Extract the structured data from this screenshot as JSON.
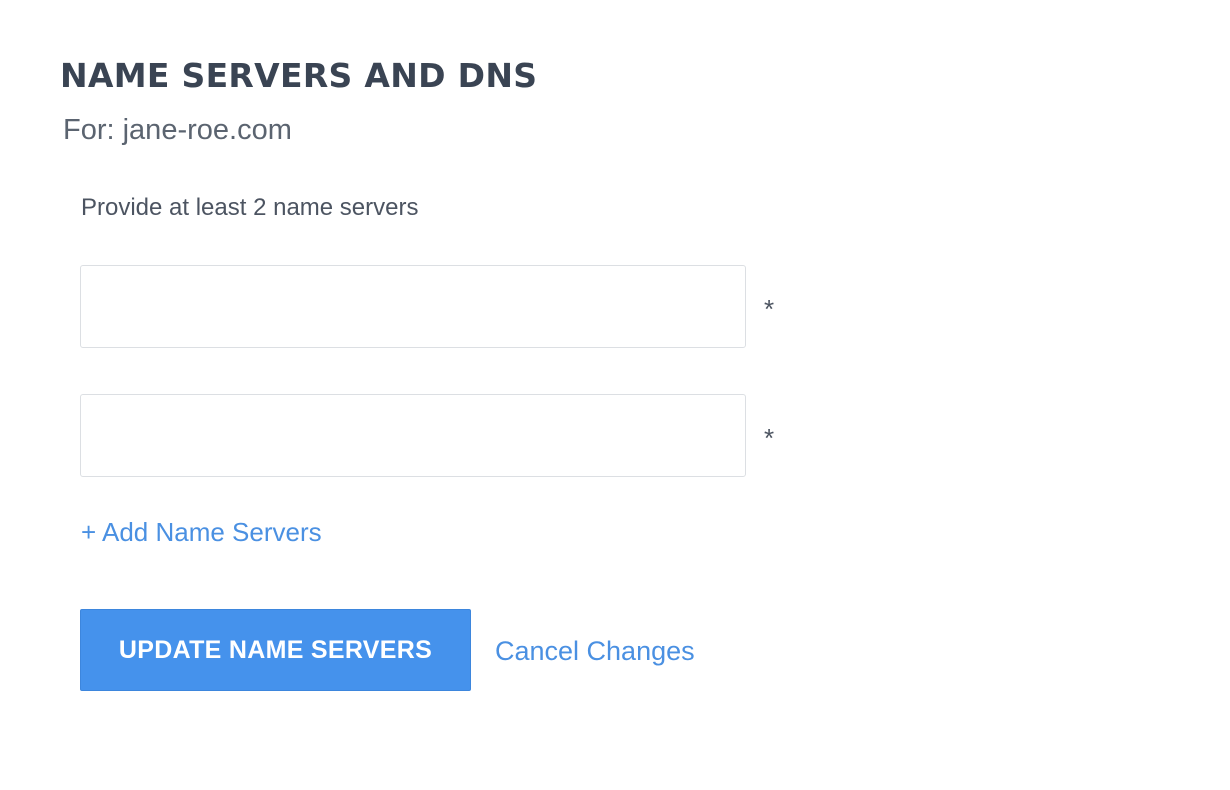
{
  "header": {
    "title": "NAME SERVERS AND DNS",
    "subtitle": "For: jane-roe.com"
  },
  "form": {
    "instructions": "Provide at least 2 name servers",
    "name_servers": [
      {
        "value": "",
        "placeholder": "",
        "required_mark": "*"
      },
      {
        "value": "",
        "placeholder": "",
        "required_mark": "*"
      }
    ],
    "add_link_label": "+ Add Name Servers",
    "submit_label": "UPDATE NAME SERVERS",
    "cancel_label": "Cancel Changes"
  },
  "colors": {
    "accent": "#4592ec",
    "link": "#4a90e2",
    "title": "#3a4453"
  }
}
